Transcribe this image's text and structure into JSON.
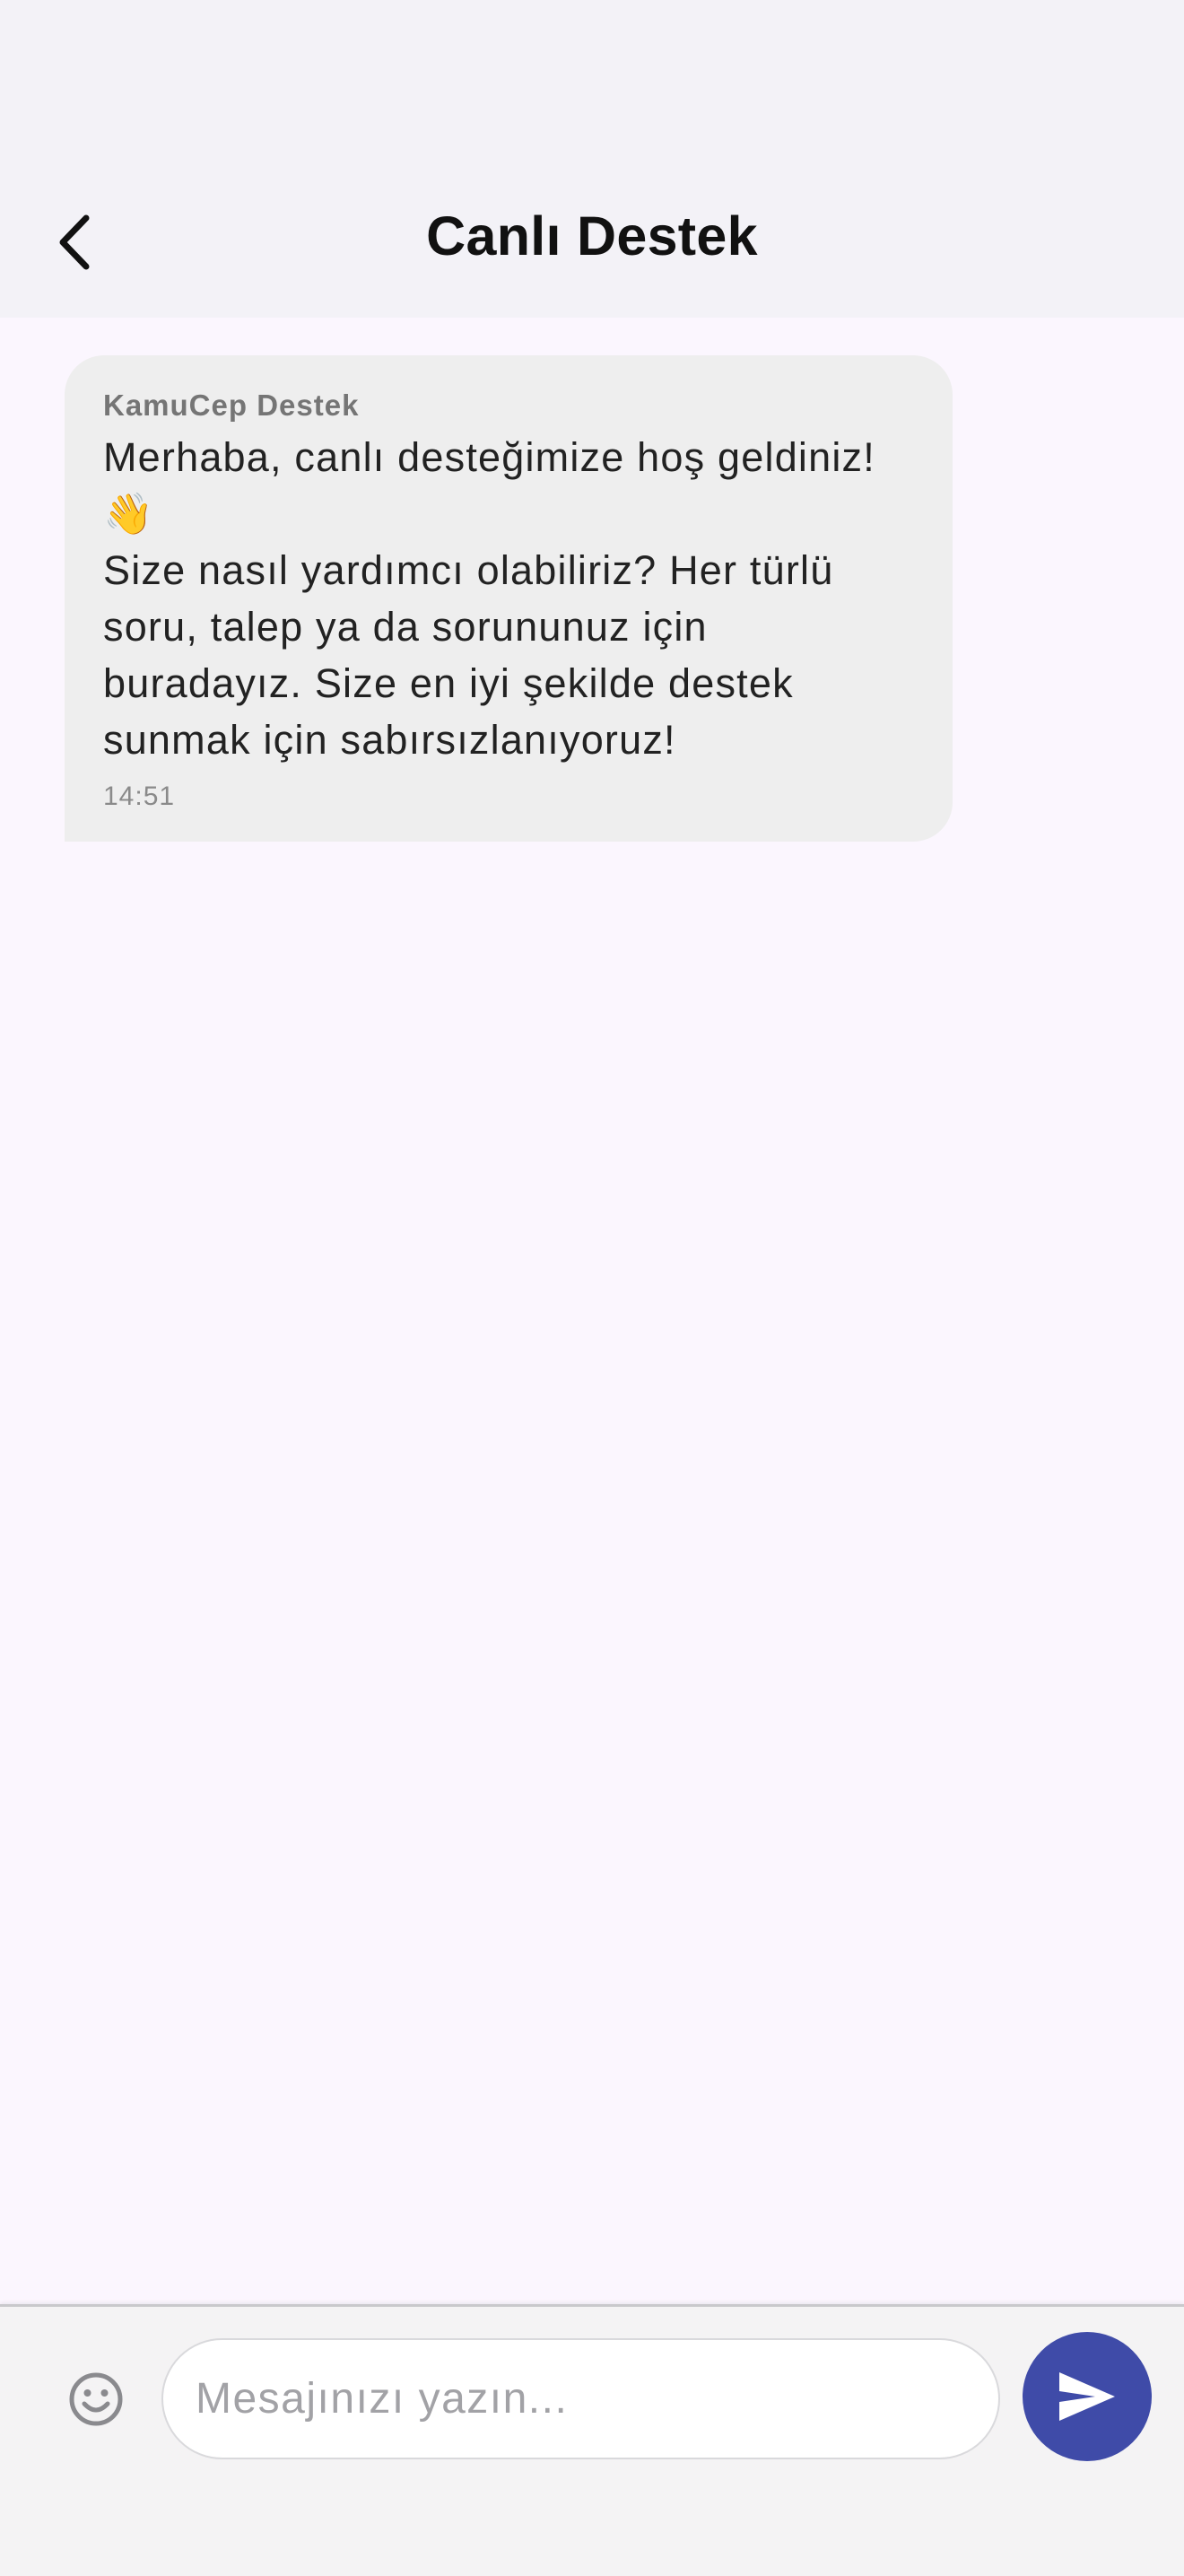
{
  "header": {
    "title": "Canlı Destek",
    "back_icon": "chevron-left-icon"
  },
  "messages": [
    {
      "sender": "KamuCep Destek",
      "text": "Merhaba, canlı desteğimize hoş geldiniz!\n👋\nSize nasıl yardımcı olabiliriz? Her türlü soru, talep ya da sorununuz için buradayız. Size en iyi şekilde destek sunmak için sabırsızlanıyoruz!",
      "time": "14:51"
    }
  ],
  "composer": {
    "placeholder": "Mesajınızı yazın...",
    "value": "",
    "emoji_icon": "smiley-icon",
    "send_icon": "send-icon"
  },
  "colors": {
    "accent": "#3f4ba8",
    "chat_background": "#fbf6fe",
    "bubble_background": "#eeeeee",
    "bar_background": "#f3f2f7"
  }
}
